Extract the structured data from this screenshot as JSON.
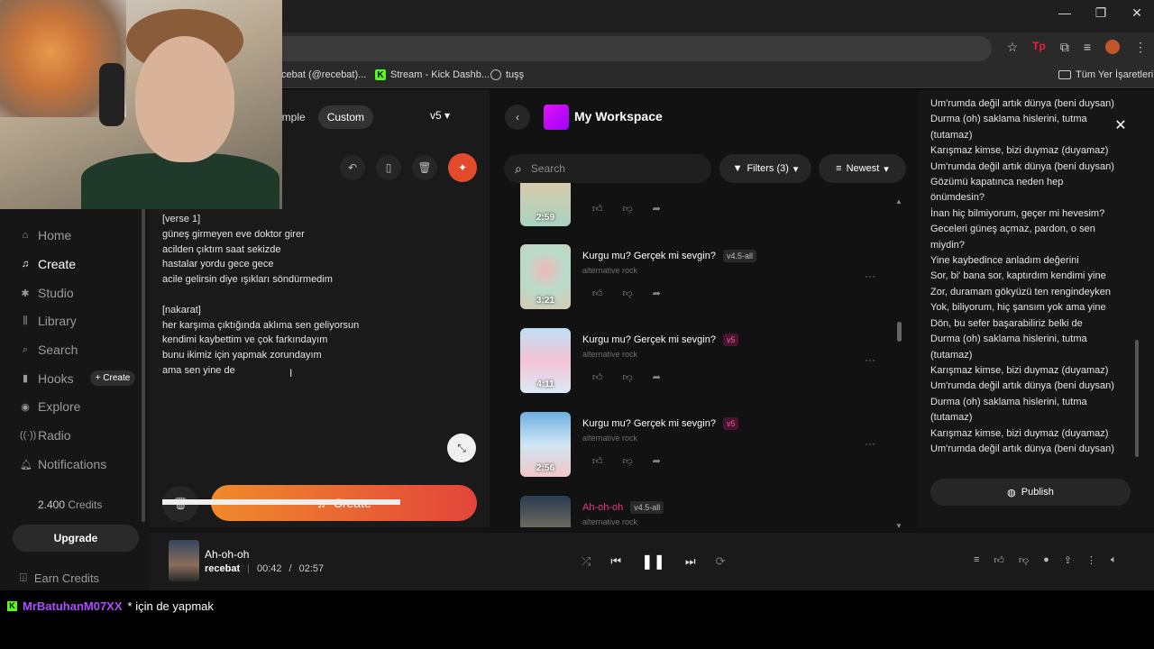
{
  "bookmarks": [
    {
      "label": "cebat (@recebat)..."
    },
    {
      "label": "Stream - Kick Dashb..."
    },
    {
      "label": "tuşş"
    },
    {
      "label": "Tüm Yer İşaretleri"
    }
  ],
  "sidebar": {
    "items": [
      {
        "label": "Home",
        "icon": "home-icon"
      },
      {
        "label": "Create",
        "icon": "music-plus-icon"
      },
      {
        "label": "Studio",
        "icon": "studio-icon"
      },
      {
        "label": "Library",
        "icon": "library-icon"
      },
      {
        "label": "Search",
        "icon": "search-icon"
      },
      {
        "label": "Hooks",
        "icon": "hooks-icon"
      },
      {
        "label": "Explore",
        "icon": "compass-icon"
      },
      {
        "label": "Radio",
        "icon": "radio-icon"
      },
      {
        "label": "Notifications",
        "icon": "bell-icon"
      }
    ],
    "hooks_create": "+ Create",
    "credits_value": "2.400",
    "credits_label": "Credits",
    "upgrade": "Upgrade",
    "earn": "Earn Credits"
  },
  "create_panel": {
    "mode_simple": "imple",
    "mode_custom": "Custom",
    "version": "v5",
    "lyrics": "[verse 1]\ngüneş girmeyen eve doktor girer\nacilden çıktım saat sekizde\nhastalar yordu gece gece\nacile gelirsin diye ışıkları söndürmedim\n\n[nakarat]\nher karşıma çıktığında aklıma sen geliyorsun\nkendimi kaybettim ve çok farkındayım\nbunu ikimiz için yapmak zorundayım\nama sen yine de",
    "create_label": "Create"
  },
  "workspace": {
    "title": "My Workspace",
    "search_placeholder": "Search",
    "filters": "Filters (3)",
    "sort": "Newest",
    "songs": [
      {
        "title": "",
        "badge": "",
        "genre": "",
        "duration": "2:59"
      },
      {
        "title": "Kurgu mu? Gerçek mi sevgin?",
        "badge": "v4.5-all",
        "genre": "alternative rock",
        "duration": "3:21"
      },
      {
        "title": "Kurgu mu? Gerçek mi sevgin?",
        "badge": "v5",
        "genre": "alternative rock",
        "duration": "4:11"
      },
      {
        "title": "Kurgu mu? Gerçek mi sevgin?",
        "badge": "v5",
        "genre": "alternative rock",
        "duration": "2:56"
      },
      {
        "title": "Ah-oh-oh",
        "badge": "v4.5-all",
        "genre": "alternative rock",
        "duration": ""
      }
    ]
  },
  "lyrics_panel": {
    "text": "Um'rumda değil artık dünya (beni duysan)\nDurma (oh) saklama hislerini, tutma\n(tutamaz)\nKarışmaz kimse, bizi duymaz (duyamaz)\nUm'rumda değil artık dünya (beni duysan)\nGözümü kapatınca neden hep\nönümdesin?\nİnan hiç bilmiyorum, geçer mi hevesim?\nGeceleri güneş açmaz, pardon, o sen\nmiydin?\nYine kaybedince anladım değerini\nSor, bi' bana sor, kaptırdım kendimi yine\nZor, duramam gökyüzü ten rengindeyken\nYok, biliyorum, hiç şansım yok ama yine\nDön, bu sefer başarabiliriz belki de\nDurma (oh) saklama hislerini, tutma\n(tutamaz)\nKarışmaz kimse, bizi duymaz (duyamaz)\nUm'rumda değil artık dünya (beni duysan)\nDurma (oh) saklama hislerini, tutma\n(tutamaz)\nKarışmaz kimse, bizi duymaz (duyamaz)\nUm'rumda değil artık dünya (beni duysan)",
    "publish": "Publish"
  },
  "player": {
    "title": "Ah-oh-oh",
    "artist": "recebat",
    "current": "00:42",
    "total": "02:57",
    "progress": 0.24
  },
  "chat": {
    "user": "MrBatuhanM07XX",
    "message": "* için de yapmak"
  },
  "colors": {
    "accent": "#e24a2b",
    "brand": "#e014f0",
    "pink": "#e93a8a"
  }
}
